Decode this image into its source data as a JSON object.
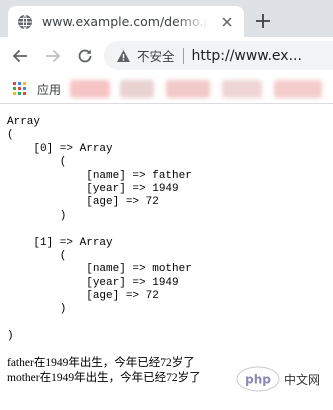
{
  "tab": {
    "title": "www.example.com/demo.php",
    "favicon": "globe-icon",
    "close": "close-icon"
  },
  "new_tab": "plus-icon",
  "toolbar": {
    "back": "back-arrow-icon",
    "forward": "forward-arrow-icon",
    "reload": "reload-icon",
    "security_icon": "warning-triangle-icon",
    "security_label": "不安全",
    "url": "http://www.ex..."
  },
  "bookmarks": {
    "apps_label": "应用",
    "apps_icon": "apps-grid-icon"
  },
  "colors": {
    "tabstrip_bg": "#dee1e6",
    "omnibox_bg": "#f1f3f4",
    "text": "#000000"
  },
  "page": {
    "output_lines": [
      "Array",
      "(",
      "    [0] => Array",
      "        (",
      "            [name] => father",
      "            [year] => 1949",
      "            [age] => 72",
      "        )",
      "",
      "    [1] => Array",
      "        (",
      "            [name] => mother",
      "            [year] => 1949",
      "            [age] => 72",
      "        )",
      "",
      ")"
    ],
    "sentences": [
      "father在1949年出生，今年已经72岁了",
      "mother在1949年出生，今年已经72岁了"
    ]
  },
  "watermark": {
    "logo": "php",
    "text": "中文网"
  }
}
